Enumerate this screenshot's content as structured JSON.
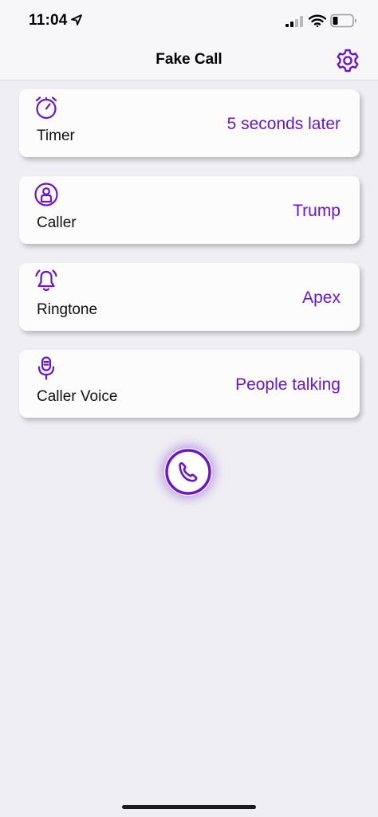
{
  "status_bar": {
    "time": "11:04"
  },
  "nav": {
    "title": "Fake Call"
  },
  "options": [
    {
      "label": "Timer",
      "value": "5 seconds later",
      "icon": "timer-icon"
    },
    {
      "label": "Caller",
      "value": "Trump",
      "icon": "person-icon"
    },
    {
      "label": "Ringtone",
      "value": "Apex",
      "icon": "bell-icon"
    },
    {
      "label": "Caller Voice",
      "value": "People talking",
      "icon": "microphone-icon"
    }
  ],
  "call_button": {
    "icon": "phone-icon"
  },
  "colors": {
    "accent": "#6a16cf",
    "background": "#efeef3",
    "card": "#fcfcfd"
  }
}
